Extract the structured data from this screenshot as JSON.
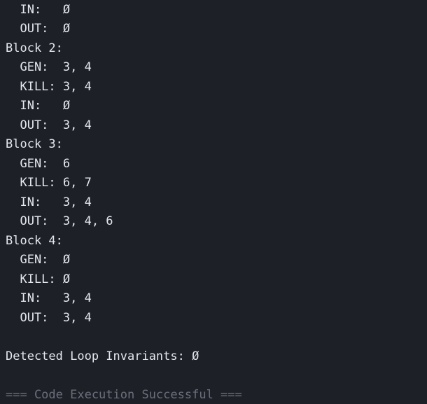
{
  "console": {
    "lines": [
      "  IN:   Ø",
      "  OUT:  Ø",
      "Block 2:",
      "  GEN:  3, 4",
      "  KILL: 3, 4",
      "  IN:   Ø",
      "  OUT:  3, 4",
      "Block 3:",
      "  GEN:  6",
      "  KILL: 6, 7",
      "  IN:   3, 4",
      "  OUT:  3, 4, 6",
      "Block 4:",
      "  GEN:  Ø",
      "  KILL: Ø",
      "  IN:   3, 4",
      "  OUT:  3, 4",
      "",
      "Detected Loop Invariants: Ø",
      "",
      "=== Code Execution Successful ==="
    ]
  },
  "colors": {
    "background": "#1e2028",
    "text": "#e6e8ee",
    "muted": "#6b6f7a"
  }
}
